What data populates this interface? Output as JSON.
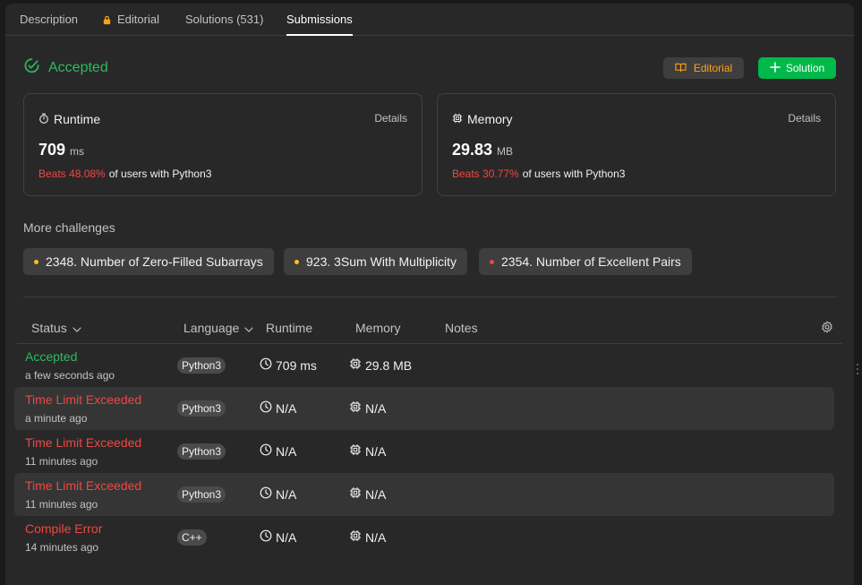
{
  "tabs": [
    {
      "label": "Description"
    },
    {
      "label": "Editorial",
      "locked": true
    },
    {
      "label": "Solutions (531)"
    },
    {
      "label": "Submissions",
      "active": true
    }
  ],
  "result": {
    "status": "Accepted"
  },
  "buttons": {
    "editorial": "Editorial",
    "solution": "Solution"
  },
  "runtime_card": {
    "title": "Runtime",
    "details": "Details",
    "value": "709",
    "unit": "ms",
    "beats": "Beats 48.08%",
    "beats_rest": "of users with Python3"
  },
  "memory_card": {
    "title": "Memory",
    "details": "Details",
    "value": "29.83",
    "unit": "MB",
    "beats": "Beats 30.77%",
    "beats_rest": "of users with Python3"
  },
  "more_challenges": {
    "title": "More challenges",
    "items": [
      {
        "label": "2348. Number of Zero-Filled Subarrays",
        "difficulty_color": "#ffc01e"
      },
      {
        "label": "923. 3Sum With Multiplicity",
        "difficulty_color": "#ffc01e"
      },
      {
        "label": "2354. Number of Excellent Pairs",
        "difficulty_color": "#ef4743"
      }
    ]
  },
  "table": {
    "headers": {
      "status": "Status",
      "language": "Language",
      "runtime": "Runtime",
      "memory": "Memory",
      "notes": "Notes"
    },
    "rows": [
      {
        "status": "Accepted",
        "time": "a few seconds ago",
        "lang": "Python3",
        "runtime": "709 ms",
        "memory": "29.8 MB"
      },
      {
        "status": "Time Limit Exceeded",
        "time": "a minute ago",
        "lang": "Python3",
        "runtime": "N/A",
        "memory": "N/A"
      },
      {
        "status": "Time Limit Exceeded",
        "time": "11 minutes ago",
        "lang": "Python3",
        "runtime": "N/A",
        "memory": "N/A"
      },
      {
        "status": "Time Limit Exceeded",
        "time": "11 minutes ago",
        "lang": "Python3",
        "runtime": "N/A",
        "memory": "N/A"
      },
      {
        "status": "Compile Error",
        "time": "14 minutes ago",
        "lang": "C++",
        "runtime": "N/A",
        "memory": "N/A"
      }
    ]
  },
  "colors": {
    "accepted": "#2cbb5d",
    "error": "#ef4743",
    "brand": "#ffa116",
    "solution_btn": "#00b94a"
  }
}
